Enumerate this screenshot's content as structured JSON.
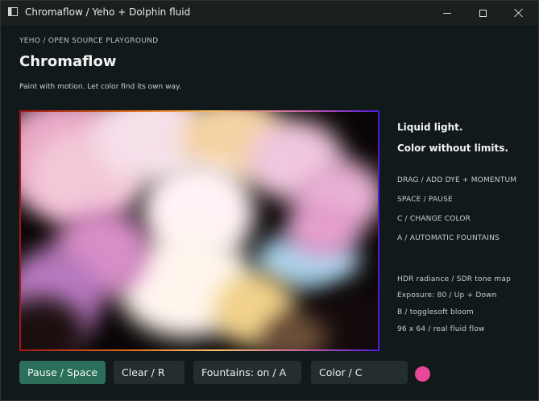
{
  "window": {
    "title": "Chromaflow / Yeho + Dolphin fluid"
  },
  "header": {
    "eyebrow": "YEHO / OPEN SOURCE PLAYGROUND",
    "title": "Chromaflow",
    "subtitle": "Paint with motion. Let color find its own way."
  },
  "sidebar": {
    "taglines": [
      "Liquid light.",
      "Color without limits."
    ],
    "controls": [
      "DRAG / ADD DYE + MOMENTUM",
      "SPACE / PAUSE",
      "C / CHANGE COLOR",
      "A / AUTOMATIC FOUNTAINS"
    ],
    "status": [
      "HDR radiance / SDR tone map",
      "Exposure: 80 / Up + Down",
      "B / togglesoft bloom",
      "96 x 64 / real fluid flow"
    ]
  },
  "toolbar": {
    "pause_label": "Pause / Space",
    "clear_label": "Clear / R",
    "fountains_label": "Fountains: on / A",
    "color_label": "Color / C"
  },
  "colors": {
    "accent": "#2b6f5a",
    "current_dye": "#e8479a",
    "background": "#12191a"
  },
  "icons": {
    "app": "app-window-icon",
    "minimize": "minimize-icon",
    "maximize": "maximize-icon",
    "close": "close-icon"
  }
}
